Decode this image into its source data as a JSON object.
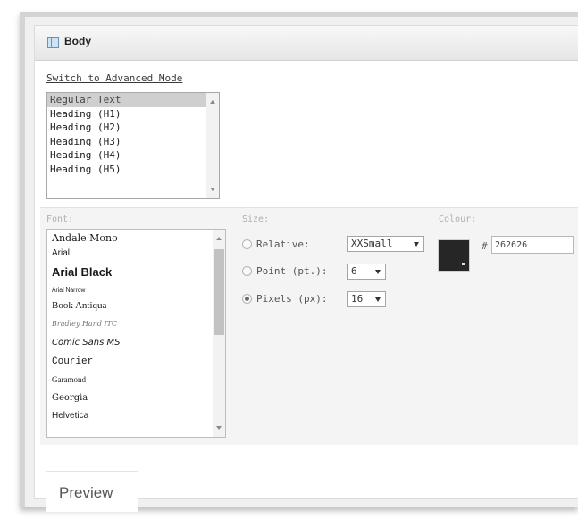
{
  "header": {
    "title": "Body",
    "icon": "text-block-icon"
  },
  "switch_link": "Switch to Advanced Mode",
  "style_options": [
    {
      "label": "Regular Text",
      "selected": true
    },
    {
      "label": "Heading (H1)",
      "selected": false
    },
    {
      "label": "Heading (H2)",
      "selected": false
    },
    {
      "label": "Heading (H3)",
      "selected": false
    },
    {
      "label": "Heading (H4)",
      "selected": false
    },
    {
      "label": "Heading (H5)",
      "selected": false
    }
  ],
  "font": {
    "label": "Font:",
    "options": [
      "Andale Mono",
      "Arial",
      "Arial Black",
      "Arial Narrow",
      "Book Antiqua",
      "Bradley Hand ITC",
      "Comic Sans MS",
      "Courier",
      "Garamond",
      "Georgia",
      "Helvetica"
    ]
  },
  "size": {
    "label": "Size:",
    "relative": {
      "label": "Relative:",
      "value": "XXSmall",
      "checked": false
    },
    "point": {
      "label": "Point (pt.):",
      "value": "6",
      "checked": false
    },
    "pixels": {
      "label": "Pixels (px):",
      "value": "16",
      "checked": true
    }
  },
  "colour": {
    "label": "Colour:",
    "hash": "#",
    "hex": "262626",
    "swatch_color": "#262626"
  },
  "preview_tab": "Preview"
}
